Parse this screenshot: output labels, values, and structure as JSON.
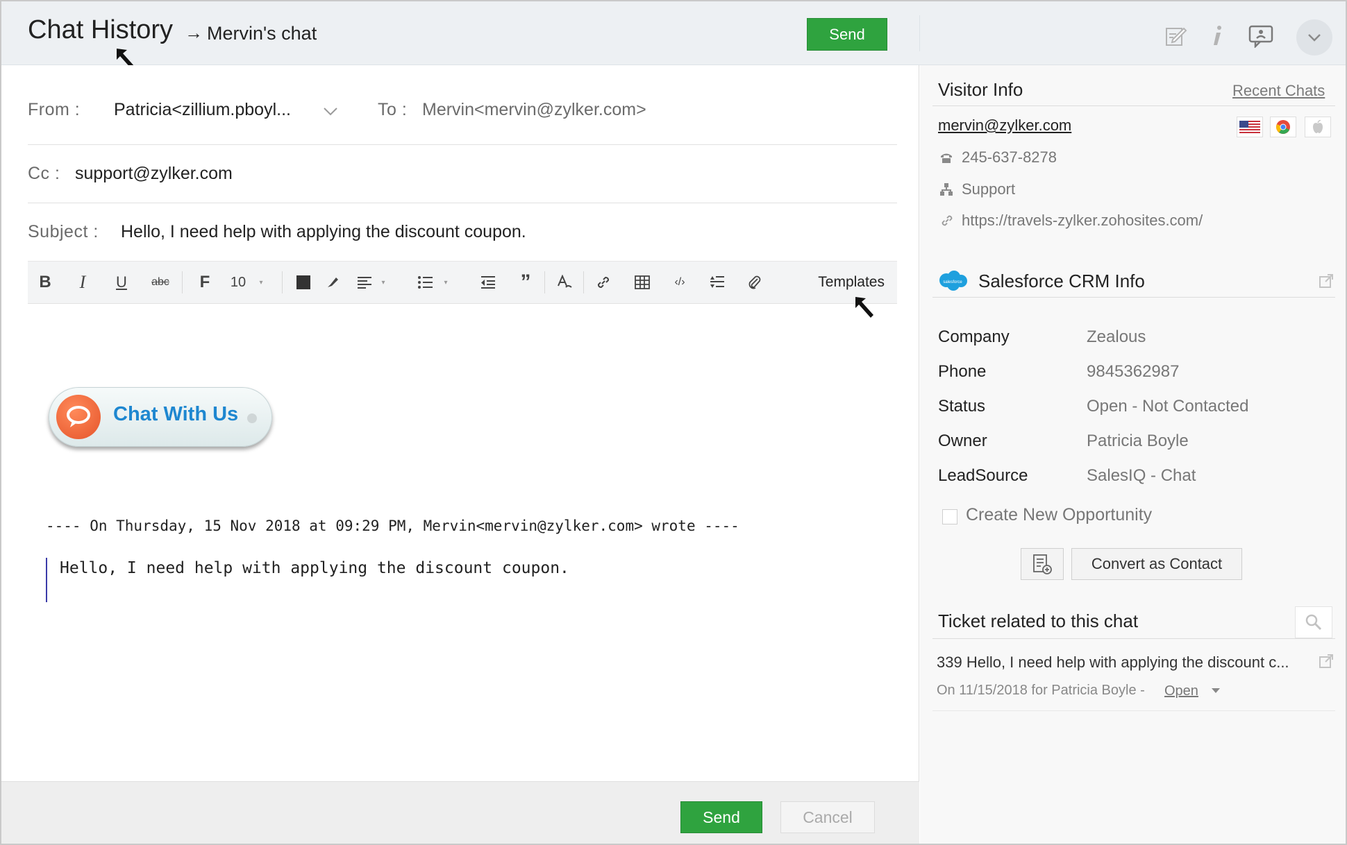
{
  "header": {
    "title": "Chat History",
    "arrow": "→",
    "breadcrumb": "Mervin's chat",
    "send_label": "Send",
    "icons": [
      "compose-icon",
      "info-icon",
      "chat-transcript-icon",
      "chevron-down-icon"
    ]
  },
  "compose": {
    "from_label": "From :",
    "from_value": "Patricia<zillium.pboyl...",
    "to_label": "To :",
    "to_value": "Mervin<mervin@zylker.com>",
    "cc_label": "Cc :",
    "cc_value": "support@zylker.com",
    "subject_label": "Subject :",
    "subject_value": "Hello, I need help with applying the discount coupon.",
    "toolbar": {
      "bold": "B",
      "italic": "I",
      "underline": "U",
      "strikethrough": "abc",
      "font": "F",
      "font_size": "10",
      "templates": "Templates"
    },
    "chat_button_label": "Chat With Us",
    "quote_header": "---- On Thursday, 15 Nov 2018 at 09:29 PM, Mervin<mervin@zylker.com> wrote ----",
    "quote_body": "Hello, I need help with applying the discount coupon."
  },
  "footer": {
    "send_label": "Send",
    "cancel_label": "Cancel"
  },
  "visitor": {
    "title": "Visitor Info",
    "recent_chats": "Recent Chats",
    "email": "mervin@zylker.com",
    "phone": "245-637-8278",
    "department": "Support",
    "url": "https://travels-zylker.zohosites.com/"
  },
  "crm": {
    "title": "Salesforce CRM Info",
    "logo_text": "salesforce",
    "rows": [
      {
        "key": "Company",
        "value": "Zealous"
      },
      {
        "key": "Phone",
        "value": "9845362987"
      },
      {
        "key": "Status",
        "value": "Open - Not Contacted"
      },
      {
        "key": "Owner",
        "value": "Patricia Boyle"
      },
      {
        "key": "LeadSource",
        "value": "SalesIQ - Chat"
      }
    ],
    "create_opportunity": "Create New Opportunity",
    "convert_contact": "Convert as Contact"
  },
  "ticket": {
    "title": "Ticket related to this chat",
    "item_title": "339 Hello, I need help with applying the discount c...",
    "item_meta": "On 11/15/2018  for Patricia Boyle -",
    "item_status": "Open"
  }
}
